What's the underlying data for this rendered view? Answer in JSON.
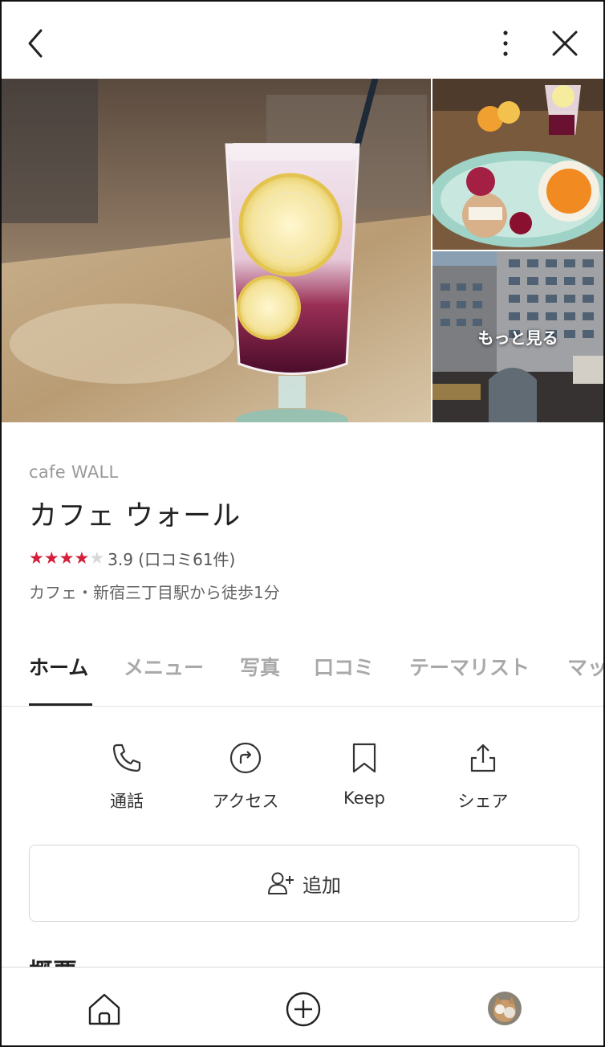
{
  "header": {
    "back_icon": "chevron-left-icon",
    "more_icon": "more-vertical-icon",
    "close_icon": "close-icon"
  },
  "photos": {
    "more_label": "もっと見る"
  },
  "place": {
    "name_en": "cafe WALL",
    "name_jp": "カフェ ウォール",
    "rating_stars": 4,
    "rating_max": 5,
    "rating_text": "3.9 (口コミ61件)",
    "category": "カフェ・新宿三丁目駅から徒歩1分"
  },
  "tabs": [
    {
      "label": "ホーム",
      "active": true
    },
    {
      "label": "メニュー",
      "active": false
    },
    {
      "label": "写真",
      "active": false
    },
    {
      "label": "口コミ",
      "active": false
    },
    {
      "label": "テーマリスト",
      "active": false
    },
    {
      "label": "マッ",
      "active": false
    }
  ],
  "actions": [
    {
      "label": "通話",
      "icon": "phone-icon"
    },
    {
      "label": "アクセス",
      "icon": "directions-icon"
    },
    {
      "label": "Keep",
      "icon": "bookmark-icon"
    },
    {
      "label": "シェア",
      "icon": "share-icon"
    }
  ],
  "add_button": {
    "label": "追加",
    "icon": "add-user-icon"
  },
  "section": {
    "overview_title": "概要"
  },
  "bottom_nav": {
    "home_icon": "home-icon",
    "post_icon": "plus-circle-icon",
    "profile_icon": "avatar"
  },
  "colors": {
    "star_active": "#d31f3a",
    "star_inactive": "#d8d8d8",
    "tab_inactive": "#a9a9a9"
  }
}
